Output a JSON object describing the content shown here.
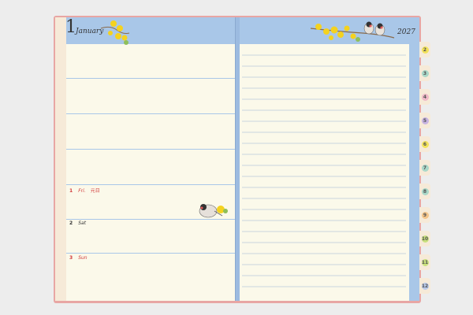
{
  "month": {
    "number": "1",
    "name": "January"
  },
  "year": "2027",
  "days": [
    {
      "num": "1",
      "weekday": "Fri.",
      "note": "元日",
      "holiday": true
    },
    {
      "num": "2",
      "weekday": "Sat",
      "note": "",
      "holiday": false
    },
    {
      "num": "3",
      "weekday": "Sun",
      "note": "",
      "holiday": true
    }
  ],
  "month_tabs": [
    {
      "label": "2",
      "color": "#f2e25a"
    },
    {
      "label": "3",
      "color": "#a9d8c8"
    },
    {
      "label": "4",
      "color": "#f0b9c8"
    },
    {
      "label": "5",
      "color": "#c8b4e2"
    },
    {
      "label": "6",
      "color": "#f2e25a"
    },
    {
      "label": "7",
      "color": "#a9d8c8"
    },
    {
      "label": "8",
      "color": "#a9d8c8"
    },
    {
      "label": "9",
      "color": "#f3c48a"
    },
    {
      "label": "10",
      "color": "#c8e07c"
    },
    {
      "label": "11",
      "color": "#c8e07c"
    },
    {
      "label": "12",
      "color": "#b8c8e8"
    }
  ],
  "colors": {
    "cover": "#e8a6a4",
    "frame": "#a9c7e8",
    "paper": "#fbf9ea",
    "holiday": "#d23b3b"
  }
}
